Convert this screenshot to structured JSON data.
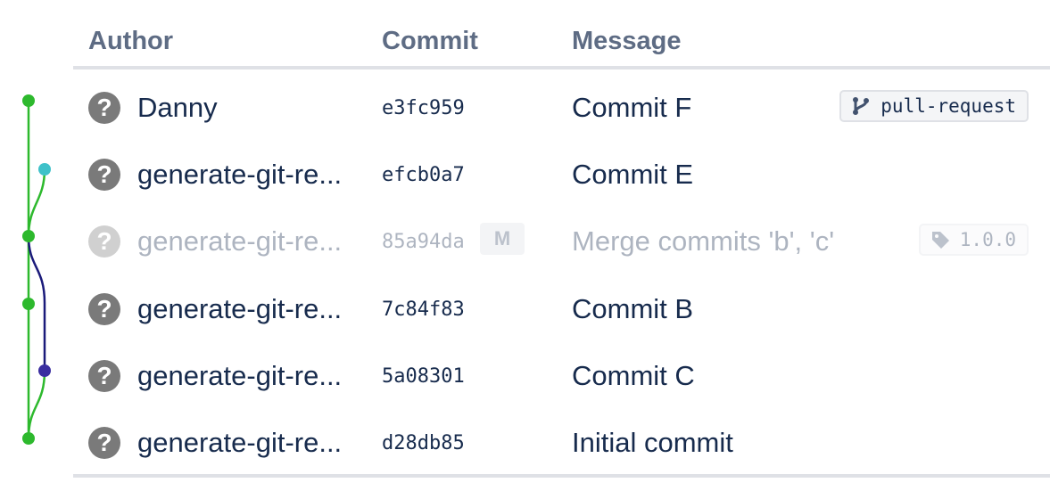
{
  "columns": {
    "author": "Author",
    "commit": "Commit",
    "message": "Message"
  },
  "commits": [
    {
      "author": "Danny",
      "hash": "e3fc959",
      "message": "Commit F",
      "ref": "pull-request",
      "ref_icon": "branch-icon"
    },
    {
      "author": "generate-git-re...",
      "hash": "efcb0a7",
      "message": "Commit E"
    },
    {
      "author": "generate-git-re...",
      "hash": "85a94da",
      "badge": "M",
      "message": "Merge commits 'b', 'c'",
      "ref": "1.0.0",
      "ref_icon": "tag-icon"
    },
    {
      "author": "generate-git-re...",
      "hash": "7c84f83",
      "message": "Commit B"
    },
    {
      "author": "generate-git-re...",
      "hash": "5a08301",
      "message": "Commit C"
    },
    {
      "author": "generate-git-re...",
      "hash": "d28db85",
      "message": "Initial commit"
    }
  ],
  "avatar_glyph": "?",
  "colors": {
    "main_branch": "#2db92d",
    "branch_e": "#3ec1c9",
    "branch_c": "#3a2ea0",
    "header_text": "#5e6c84",
    "divider": "#dfe1e6"
  }
}
